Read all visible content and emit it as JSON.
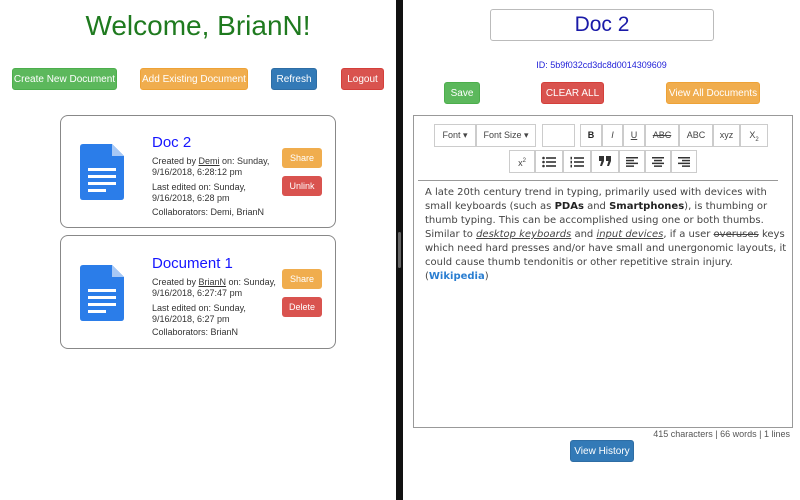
{
  "left": {
    "welcome": "Welcome, BrianN!",
    "buttons": {
      "create": "Create New Document",
      "add": "Add Existing Document",
      "refresh": "Refresh",
      "logout": "Logout"
    },
    "documents": [
      {
        "title": "Doc 2",
        "created_prefix": "Created by ",
        "creator": "Demi",
        "created_suffix": " on: Sunday, 9/16/2018, 6:28:12 pm",
        "edited": "Last edited on: Sunday, 9/16/2018, 6:28 pm",
        "collaborators": "Collaborators: Demi, BrianN",
        "share_label": "Share",
        "action_label": "Unlink"
      },
      {
        "title": "Document 1",
        "created_prefix": "Created by ",
        "creator": "BrianN",
        "created_suffix": " on: Sunday, 9/16/2018, 6:27:47 pm",
        "edited": "Last edited on: Sunday, 9/16/2018, 6:27 pm",
        "collaborators": "Collaborators: BrianN",
        "share_label": "Share",
        "action_label": "Delete"
      }
    ]
  },
  "right": {
    "doc_title": "Doc 2",
    "doc_id": "ID: 5b9f032cd3dc8d0014309609",
    "buttons": {
      "save": "Save",
      "clear": "CLEAR ALL",
      "view_all": "View All Documents",
      "history": "View History"
    },
    "toolbar": {
      "font": "Font",
      "font_size": "Font Size",
      "bold": "B",
      "italic": "I",
      "underline": "U",
      "strikethrough": "ABC",
      "uppercase": "ABC",
      "lowercase": "xyz",
      "subscript_base": "X",
      "subscript_mark": "2",
      "superscript_base": "x",
      "superscript_mark": "2"
    },
    "content": {
      "p1": "A late 20th century trend in typing, primarily used with devices with small keyboards (such as ",
      "b1": "PDAs",
      "p2": " and ",
      "b2": "Smartphones",
      "p3": "), is thumbing or thumb typing. This can be accomplished using one or both thumbs. Similar to ",
      "link1": "desktop keyboards",
      "p4": " and ",
      "link2": "input devices",
      "p5": ", if a user ",
      "strike": "overuses",
      "p6": " keys which need hard presses and/or have small and unergonomic layouts, it could cause thumb tendonitis or other repetitive strain injury. (",
      "wiki": "Wikipedia",
      "p7": ")"
    },
    "stats": "415 characters | 66 words | 1 lines"
  },
  "colors": {
    "welcome": "#1f7a1f",
    "doc_title": "#1515ff",
    "success": "#5cb85c",
    "warning": "#f0ad4e",
    "primary": "#337ab7",
    "danger": "#d9534f",
    "doc_icon": "#2b7de9"
  }
}
